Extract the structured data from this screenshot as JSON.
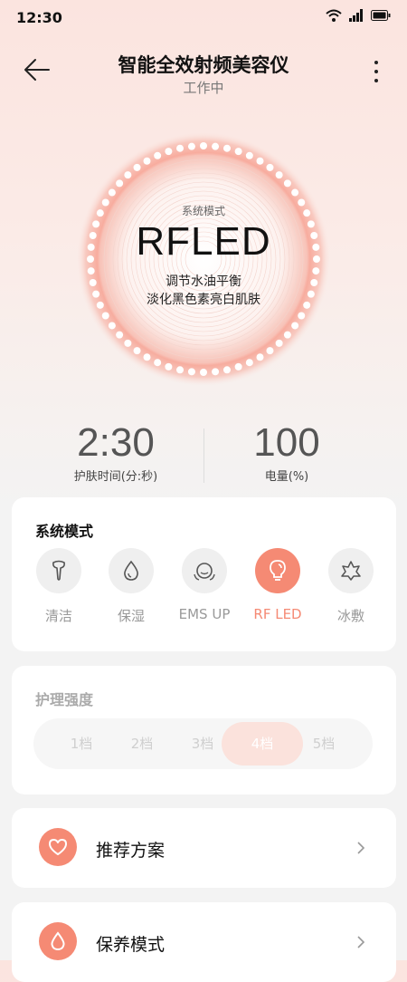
{
  "status_bar": {
    "time": "12:30"
  },
  "header": {
    "title": "智能全效射频美容仪",
    "subtitle": "工作中"
  },
  "device": {
    "mode_caption": "系统模式",
    "mode_name": "RFLED",
    "desc_line1": "调节水油平衡",
    "desc_line2": "淡化黑色素亮白肌肤"
  },
  "stats": {
    "time_value": "2:30",
    "time_label": "护肤时间(分:秒)",
    "battery_value": "100",
    "battery_label": "电量(%)"
  },
  "modes_card": {
    "title": "系统模式",
    "items": [
      {
        "label": "清洁",
        "icon": "cleanser-icon",
        "active": false
      },
      {
        "label": "保湿",
        "icon": "water-drop-icon",
        "active": false
      },
      {
        "label": "EMS UP",
        "icon": "face-lift-icon",
        "active": false
      },
      {
        "label": "RF LED",
        "icon": "light-bulb-icon",
        "active": true
      },
      {
        "label": "冰敷",
        "icon": "snowflake-star-icon",
        "active": false
      }
    ]
  },
  "intensity_card": {
    "title": "护理强度",
    "levels": [
      "1档",
      "2档",
      "3档",
      "4档",
      "5档"
    ],
    "selected": "4档"
  },
  "menu": {
    "recommend_label": "推荐方案",
    "care_label": "保养模式"
  },
  "colors": {
    "accent": "#f58a74",
    "ring": "#f7a596"
  }
}
